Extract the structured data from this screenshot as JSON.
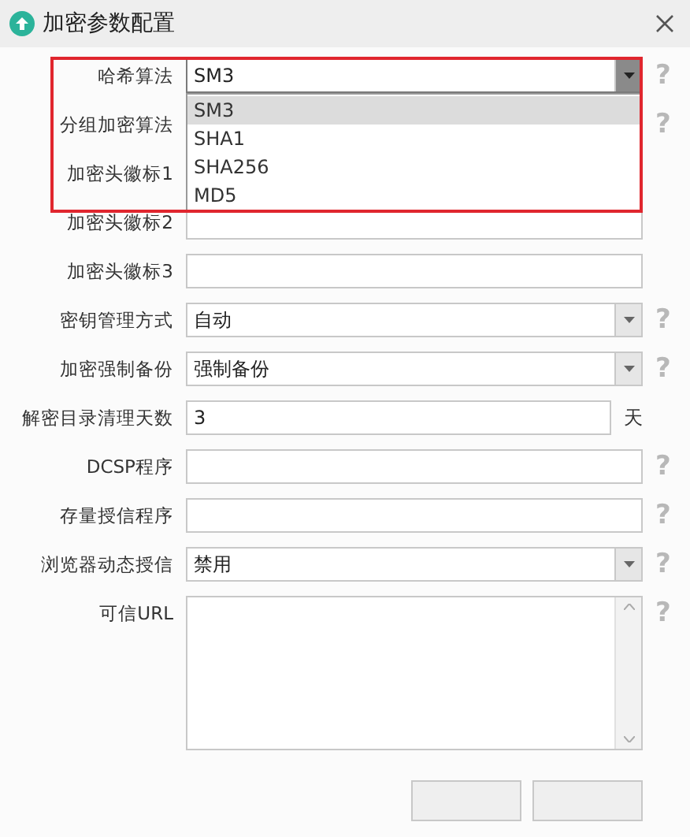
{
  "window": {
    "title": "加密参数配置"
  },
  "fields": [
    {
      "label": "哈希算法",
      "kind": "select",
      "value": "SM3",
      "open": true,
      "help": "?"
    },
    {
      "label": "分组加密算法",
      "kind": "covered",
      "help": "?"
    },
    {
      "label": "加密头徽标1",
      "kind": "covered"
    },
    {
      "label": "加密头徽标2",
      "kind": "text"
    },
    {
      "label": "加密头徽标3",
      "kind": "text"
    },
    {
      "label": "密钥管理方式",
      "kind": "select",
      "value": "自动",
      "open": false,
      "help": "?"
    },
    {
      "label": "加密强制备份",
      "kind": "select",
      "value": "强制备份",
      "open": false,
      "help": "?"
    },
    {
      "label": "解密目录清理天数",
      "kind": "text",
      "value": "3",
      "unit": "天"
    },
    {
      "label": "DCSP程序",
      "kind": "text",
      "help": "?"
    },
    {
      "label": "存量授信程序",
      "kind": "text",
      "help": "?"
    },
    {
      "label": "浏览器动态授信",
      "kind": "select",
      "value": "禁用",
      "open": false,
      "help": "?"
    },
    {
      "label": "可信URL",
      "kind": "textarea",
      "help": "?"
    }
  ],
  "dropdown": {
    "options": [
      {
        "label": "SM3",
        "selected": true
      },
      {
        "label": "SHA1",
        "selected": false
      },
      {
        "label": "SHA256",
        "selected": false
      },
      {
        "label": "MD5",
        "selected": false
      }
    ]
  },
  "buttons": [
    {
      "kind": "button"
    },
    {
      "kind": "button"
    }
  ]
}
